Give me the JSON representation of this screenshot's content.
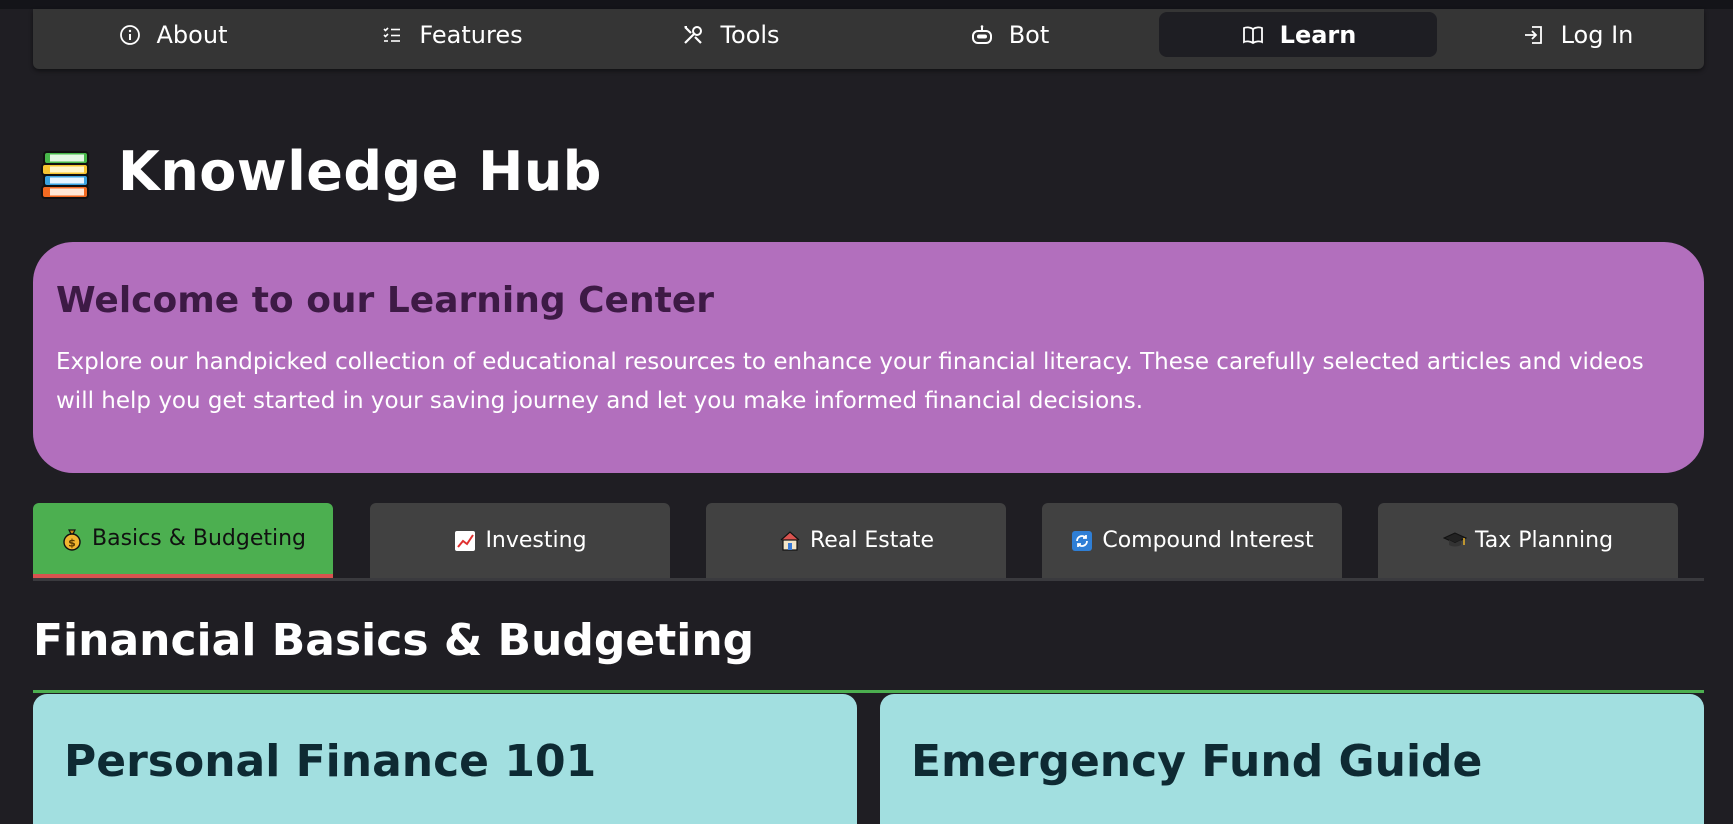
{
  "nav": {
    "items": [
      {
        "label": "About",
        "icon": "info-icon"
      },
      {
        "label": "Features",
        "icon": "list-icon"
      },
      {
        "label": "Tools",
        "icon": "tools-icon"
      },
      {
        "label": "Bot",
        "icon": "robot-icon"
      },
      {
        "label": "Learn",
        "icon": "book-icon",
        "active": true
      },
      {
        "label": "Log In",
        "icon": "login-icon"
      }
    ]
  },
  "hero": {
    "title": "Knowledge Hub",
    "icon": "books-icon"
  },
  "welcome": {
    "heading": "Welcome to our Learning Center",
    "body": "Explore our handpicked collection of educational resources to enhance your financial literacy. These carefully selected articles and videos will help you get started in your saving journey and let you make informed financial decisions."
  },
  "tabs": [
    {
      "label": "Basics & Budgeting",
      "icon": "money-bag-icon",
      "active": true
    },
    {
      "label": "Investing",
      "icon": "chart-increasing-icon"
    },
    {
      "label": "Real Estate",
      "icon": "house-icon"
    },
    {
      "label": "Compound Interest",
      "icon": "refresh-icon"
    },
    {
      "label": "Tax Planning",
      "icon": "graduation-cap-icon"
    }
  ],
  "section": {
    "title": "Financial Basics & Budgeting"
  },
  "cards": [
    {
      "title": "Personal Finance 101"
    },
    {
      "title": "Emergency Fund Guide"
    }
  ],
  "colors": {
    "background": "#1f1e23",
    "navbar": "#353535",
    "welcome_bg": "#b26fbd",
    "active_tab": "#4caf50",
    "active_tab_underline": "#d9534f",
    "card_bg": "#a2dfe0"
  }
}
